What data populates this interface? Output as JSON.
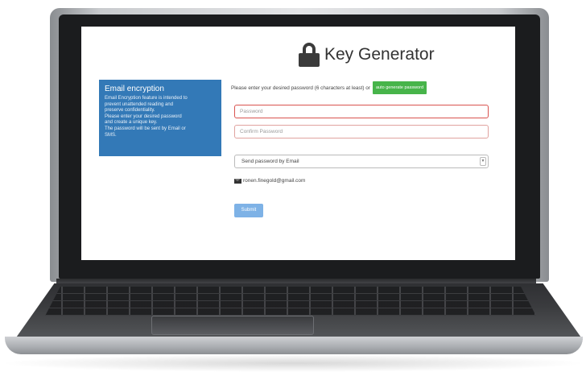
{
  "page": {
    "title": "Key Generator"
  },
  "sidebar": {
    "title": "Email encryption",
    "text_lines": [
      "Email Encryption feature is intended to",
      "prevent unattended reading and",
      "preserve confidentiality.",
      "Please enter your desired password",
      "and create a unique key.",
      "The password will be sent by Email or",
      "SMS."
    ]
  },
  "form": {
    "intro": "Please enter your desired password (6 characters at least) or",
    "auto_generate_label": "auto generate password",
    "password_placeholder": "Password",
    "confirm_placeholder": "Confirm Password",
    "send_method": "Send password by Email",
    "email": "ronen.finegold@gmail.com",
    "submit_label": "Submit"
  },
  "colors": {
    "info_box": "#3379b7",
    "generate_button": "#47b44a",
    "input_error_border": "#d9534f",
    "submit_button": "#7eb2e6"
  },
  "icons": {
    "title": "lock-icon",
    "email": "envelope-icon",
    "select": "chevron-down-icon"
  }
}
